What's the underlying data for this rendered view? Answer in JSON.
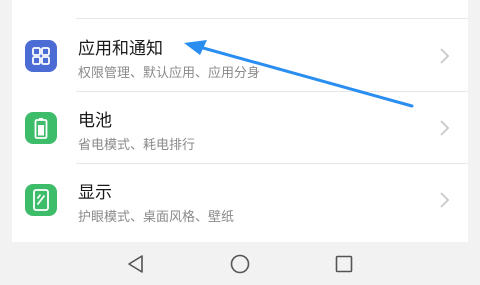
{
  "settings": {
    "items": [
      {
        "title": "应用和通知",
        "subtitle": "权限管理、默认应用、应用分身",
        "icon": "apps-grid-icon",
        "icon_color": "#4a6cd4"
      },
      {
        "title": "电池",
        "subtitle": "省电模式、耗电排行",
        "icon": "battery-icon",
        "icon_color": "#3dbd6a"
      },
      {
        "title": "显示",
        "subtitle": "护眼模式、桌面风格、壁纸",
        "icon": "display-icon",
        "icon_color": "#3dbd6a"
      }
    ],
    "chevron_icon": "chevron-right-icon"
  },
  "navbar": {
    "back_icon": "back-triangle-icon",
    "home_icon": "home-circle-icon",
    "recents_icon": "recents-square-icon"
  },
  "annotation": {
    "arrow_icon": "blue-arrow-icon",
    "arrow_color": "#2a8ef0"
  }
}
